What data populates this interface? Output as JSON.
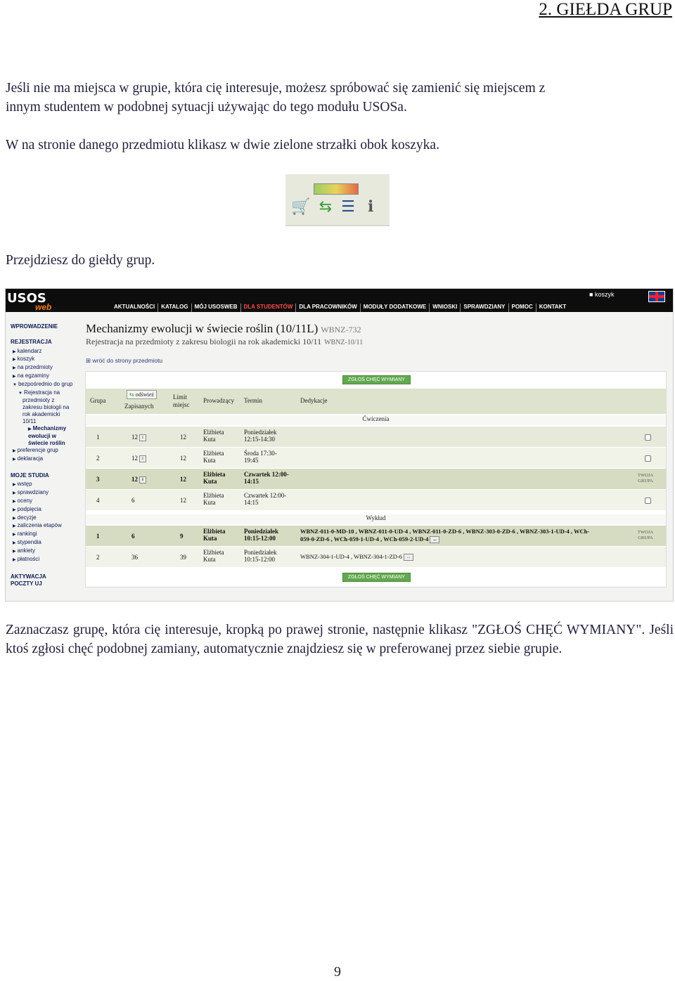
{
  "heading": "2. GIEŁDA GRUP",
  "paragraphs": {
    "p1_line1": "Jeśli nie ma miejsca w grupie, która cię interesuje, możesz spróbować się zamienić się miejscem z",
    "p1_line2": "innym studentem w podobnej sytuacji używając do tego modułu USOSa.",
    "p2": "W na stronie danego przedmiotu klikasz w dwie zielone strzałki obok koszyka.",
    "p3": "Przejdziesz do giełdy grup.",
    "p4": "Zaznaczasz grupę, która cię interesuje, kropką po prawej stronie, następnie klikasz \"ZGŁOŚ CHĘĆ WYMIANY\". Jeśli ktoś zgłosi chęć podobnej zamiany, automatycznie znajdziesz się w preferowanej przez siebie grupie."
  },
  "icons": [
    "cart-icon",
    "exchange-arrows-icon",
    "list-icon",
    "info-icon"
  ],
  "usos": {
    "logo": "USOS",
    "logo_sub": "web",
    "cart": "koszyk",
    "nav": [
      "AKTUALNOŚCI",
      "KATALOG",
      "MÓJ USOSWEB",
      "DLA STUDENTÓW",
      "DLA PRACOWNIKÓW",
      "MODUŁY DODATKOWE",
      "WNIOSKI",
      "SPRAWDZIANY",
      "POMOC",
      "KONTAKT"
    ],
    "sidebar": {
      "s1": "WPROWADZENIE",
      "s2": "REJESTRACJA",
      "i1": "kalendarz",
      "i2": "koszyk",
      "i3": "na przedmioty",
      "i4": "na egzaminy",
      "i5": "bezpośrednio do grup",
      "i6": "Rejestracja na",
      "i6b": "przedmioty z",
      "i6c": "zakresu biologii na",
      "i6d": "rok akademicki",
      "i6e": "10/11",
      "cur1": "Mechanizmy",
      "cur2": "ewolucji w",
      "cur3": "świecie roślin",
      "i7": "preferencje grup",
      "i8": "deklaracja",
      "s3": "MOJE STUDIA",
      "m1": "wstęp",
      "m2": "sprawdziany",
      "m3": "oceny",
      "m4": "podpięcia",
      "m5": "decyzje",
      "m6": "zaliczenia etapów",
      "m7": "rankingi",
      "m8": "stypendia",
      "m9": "ankiety",
      "m10": "płatności",
      "s4a": "AKTYWACJA",
      "s4b": "POCZTY UJ"
    },
    "title": "Mechanizmy ewolucji w świecie roślin (10/11L)",
    "title_code": "WBNZ-732",
    "subtitle": "Rejestracja na przedmioty z zakresu biologii na rok akademicki 10/11",
    "subtitle_code": "WBNZ-10/11",
    "back_link": "wróć do strony przedmiotu",
    "exchange_button": "ZGŁOŚ CHĘĆ WYMIANY",
    "headers": {
      "grupa": "Grupa",
      "refresh": "odśwież",
      "zapisanych": "Zapisanych",
      "limit1": "Limit",
      "limit2": "miejsc",
      "prowadzacy": "Prowadzący",
      "termin": "Termin",
      "dedykacje": "Dedykacje"
    },
    "cat_cwiczenia": "Ćwiczenia",
    "cat_wyklad": "Wykład",
    "info_label": "i",
    "more_label": "...",
    "rows_cw": [
      {
        "grupa": "1",
        "zapis": "12",
        "limit": "12",
        "prow1": "Elżbieta",
        "prow2": "Kuta",
        "term1": "Poniedziałek",
        "term2": "12:15-14:30"
      },
      {
        "grupa": "2",
        "zapis": "12",
        "limit": "12",
        "prow1": "Elżbieta",
        "prow2": "Kuta",
        "term1": "Środa 17:30-",
        "term2": "19:45"
      },
      {
        "grupa": "3",
        "zapis": "12",
        "limit": "12",
        "prow1": "Elżbieta",
        "prow2": "Kuta",
        "term1": "Czwartek 12:00-",
        "term2": "14:15",
        "twoja1": "TWOJA",
        "twoja2": "GRUPA"
      },
      {
        "grupa": "4",
        "zapis": "6",
        "limit": "12",
        "prow1": "Elżbieta",
        "prow2": "Kuta",
        "term1": "Czwartek 12:00-",
        "term2": "14:15"
      }
    ],
    "rows_wyk": [
      {
        "grupa": "1",
        "zapis": "6",
        "limit": "9",
        "prow1": "Elżbieta",
        "prow2": "Kuta",
        "term1": "Poniedziałek",
        "term2": "10:15-12:00",
        "ded1": "WBNZ-011-0-MD-10 , WBNZ-011-0-UD-4 , WBNZ-011-0-ZD-6 , WBNZ-303-0-ZD-6 , WBNZ-303-1-UD-4 , WCh-",
        "ded2": "059-0-ZD-6 , WCh-059-1-UD-4 , WCh-059-2-UD-4",
        "twoja1": "TWOJA",
        "twoja2": "GRUPA"
      },
      {
        "grupa": "2",
        "zapis": "36",
        "limit": "39",
        "prow1": "Elżbieta",
        "prow2": "Kuta",
        "term1": "Poniedziałek",
        "term2": "10:15-12:00",
        "ded1": "WBNZ-304-1-UD-4 , WBNZ-304-1-ZD-6"
      }
    ]
  },
  "page_number": "9"
}
